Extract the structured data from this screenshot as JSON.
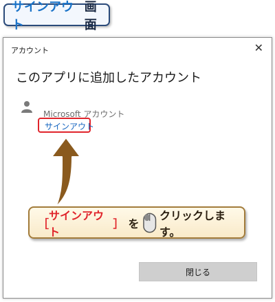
{
  "badge": {
    "highlight": "サインアウト",
    "text": "画面"
  },
  "dialog": {
    "title": "アカウント",
    "close_glyph": "✕",
    "heading": "このアプリに追加したアカウント",
    "account": {
      "name": "Microsoft アカウント"
    },
    "signout_label": "サインアウト",
    "close_button_label": "閉じる"
  },
  "callout": {
    "bracket_open": "［",
    "target": "サインアウト",
    "bracket_close": "］",
    "particle": "を",
    "action": "クリックします。"
  },
  "colors": {
    "accent_blue": "#1a73c8",
    "highlight_red": "#e0242b",
    "arrow_brown": "#8a5a1e",
    "callout_bg": "#fff4dc"
  },
  "icons": [
    "person-icon",
    "close-icon",
    "up-arrow-icon",
    "mouse-icon"
  ]
}
